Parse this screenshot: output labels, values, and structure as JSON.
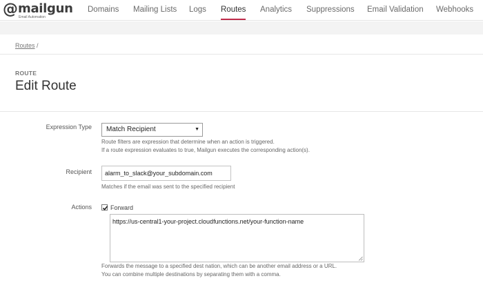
{
  "logo": {
    "word": "mailgun",
    "at": "@",
    "tagline": "Email Automation"
  },
  "nav": {
    "items": [
      {
        "label": "Domains",
        "active": false
      },
      {
        "label": "Mailing Lists",
        "active": false
      },
      {
        "label": "Logs",
        "active": false
      },
      {
        "label": "Routes",
        "active": true
      },
      {
        "label": "Analytics",
        "active": false
      },
      {
        "label": "Suppressions",
        "active": false
      },
      {
        "label": "Email Validation",
        "active": false
      },
      {
        "label": "Webhooks",
        "active": false
      }
    ],
    "accent_color": "#c02b4b"
  },
  "breadcrumb": {
    "link": "Routes",
    "separator": "/"
  },
  "header": {
    "eyebrow": "ROUTE",
    "title": "Edit Route"
  },
  "form": {
    "expression_type": {
      "label": "Expression Type",
      "selected": "Match Recipient",
      "help_line1": "Route filters are expression that determine when an action is triggered.",
      "help_line2": "If a route expression evaluates to true, Mailgun executes the corresponding action(s)."
    },
    "recipient": {
      "label": "Recipient",
      "value": "alarm_to_slack@your_subdomain.com",
      "help": "Matches if the email was sent to the specified recipient"
    },
    "actions": {
      "label": "Actions",
      "forward_checked": true,
      "forward_label": "Forward",
      "forward_value": "https://us-central1-your-project.cloudfunctions.net/your-function-name",
      "help_line1": "Forwards the message to a specified dest nation, which can be another email address or a URL.",
      "help_line2": "You can combine multiple destinations by separating them with a comma."
    }
  }
}
